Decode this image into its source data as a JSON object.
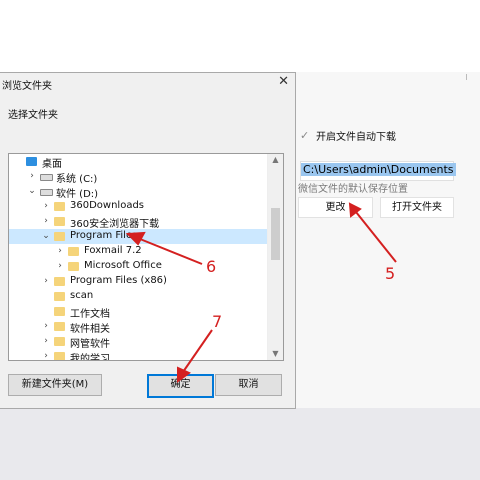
{
  "dialog": {
    "title": "浏览文件夹",
    "subtitle": "选择文件夹",
    "close_glyph": "✕",
    "tree": [
      {
        "label": "桌面",
        "expander": "",
        "icon": "desktop",
        "indent": 0
      },
      {
        "label": "系统 (C:)",
        "expander": "›",
        "icon": "drive",
        "indent": 1
      },
      {
        "label": "软件 (D:)",
        "expander": "⌄",
        "icon": "drive",
        "indent": 1
      },
      {
        "label": "360Downloads",
        "expander": "›",
        "icon": "folder",
        "indent": 2
      },
      {
        "label": "360安全浏览器下载",
        "expander": "›",
        "icon": "folder",
        "indent": 2
      },
      {
        "label": "Program Files",
        "expander": "⌄",
        "icon": "folder",
        "indent": 2,
        "selected": true
      },
      {
        "label": "Foxmail 7.2",
        "expander": "›",
        "icon": "folder",
        "indent": 3
      },
      {
        "label": "Microsoft Office",
        "expander": "›",
        "icon": "folder",
        "indent": 3
      },
      {
        "label": "Program Files (x86)",
        "expander": "›",
        "icon": "folder",
        "indent": 2
      },
      {
        "label": "scan",
        "expander": "",
        "icon": "folder",
        "indent": 2
      },
      {
        "label": "工作文档",
        "expander": "",
        "icon": "folder",
        "indent": 2
      },
      {
        "label": "软件相关",
        "expander": "›",
        "icon": "folder",
        "indent": 2
      },
      {
        "label": "网管软件",
        "expander": "›",
        "icon": "folder",
        "indent": 2
      },
      {
        "label": "我的学习",
        "expander": "›",
        "icon": "folder",
        "indent": 2
      }
    ],
    "buttons": {
      "new_folder": "新建文件夹(M)",
      "ok": "确定",
      "cancel": "取消"
    }
  },
  "settings": {
    "auto_download_label": "开启文件自动下载",
    "auto_download_checked": true,
    "path_value": "C:\\Users\\admin\\Documents",
    "hint": "微信文件的默认保存位置",
    "change_button": "更改",
    "open_folder_button": "打开文件夹"
  },
  "annotations": {
    "arrow_5": "5",
    "arrow_6": "6",
    "arrow_7": "7",
    "color": "#d42020"
  }
}
